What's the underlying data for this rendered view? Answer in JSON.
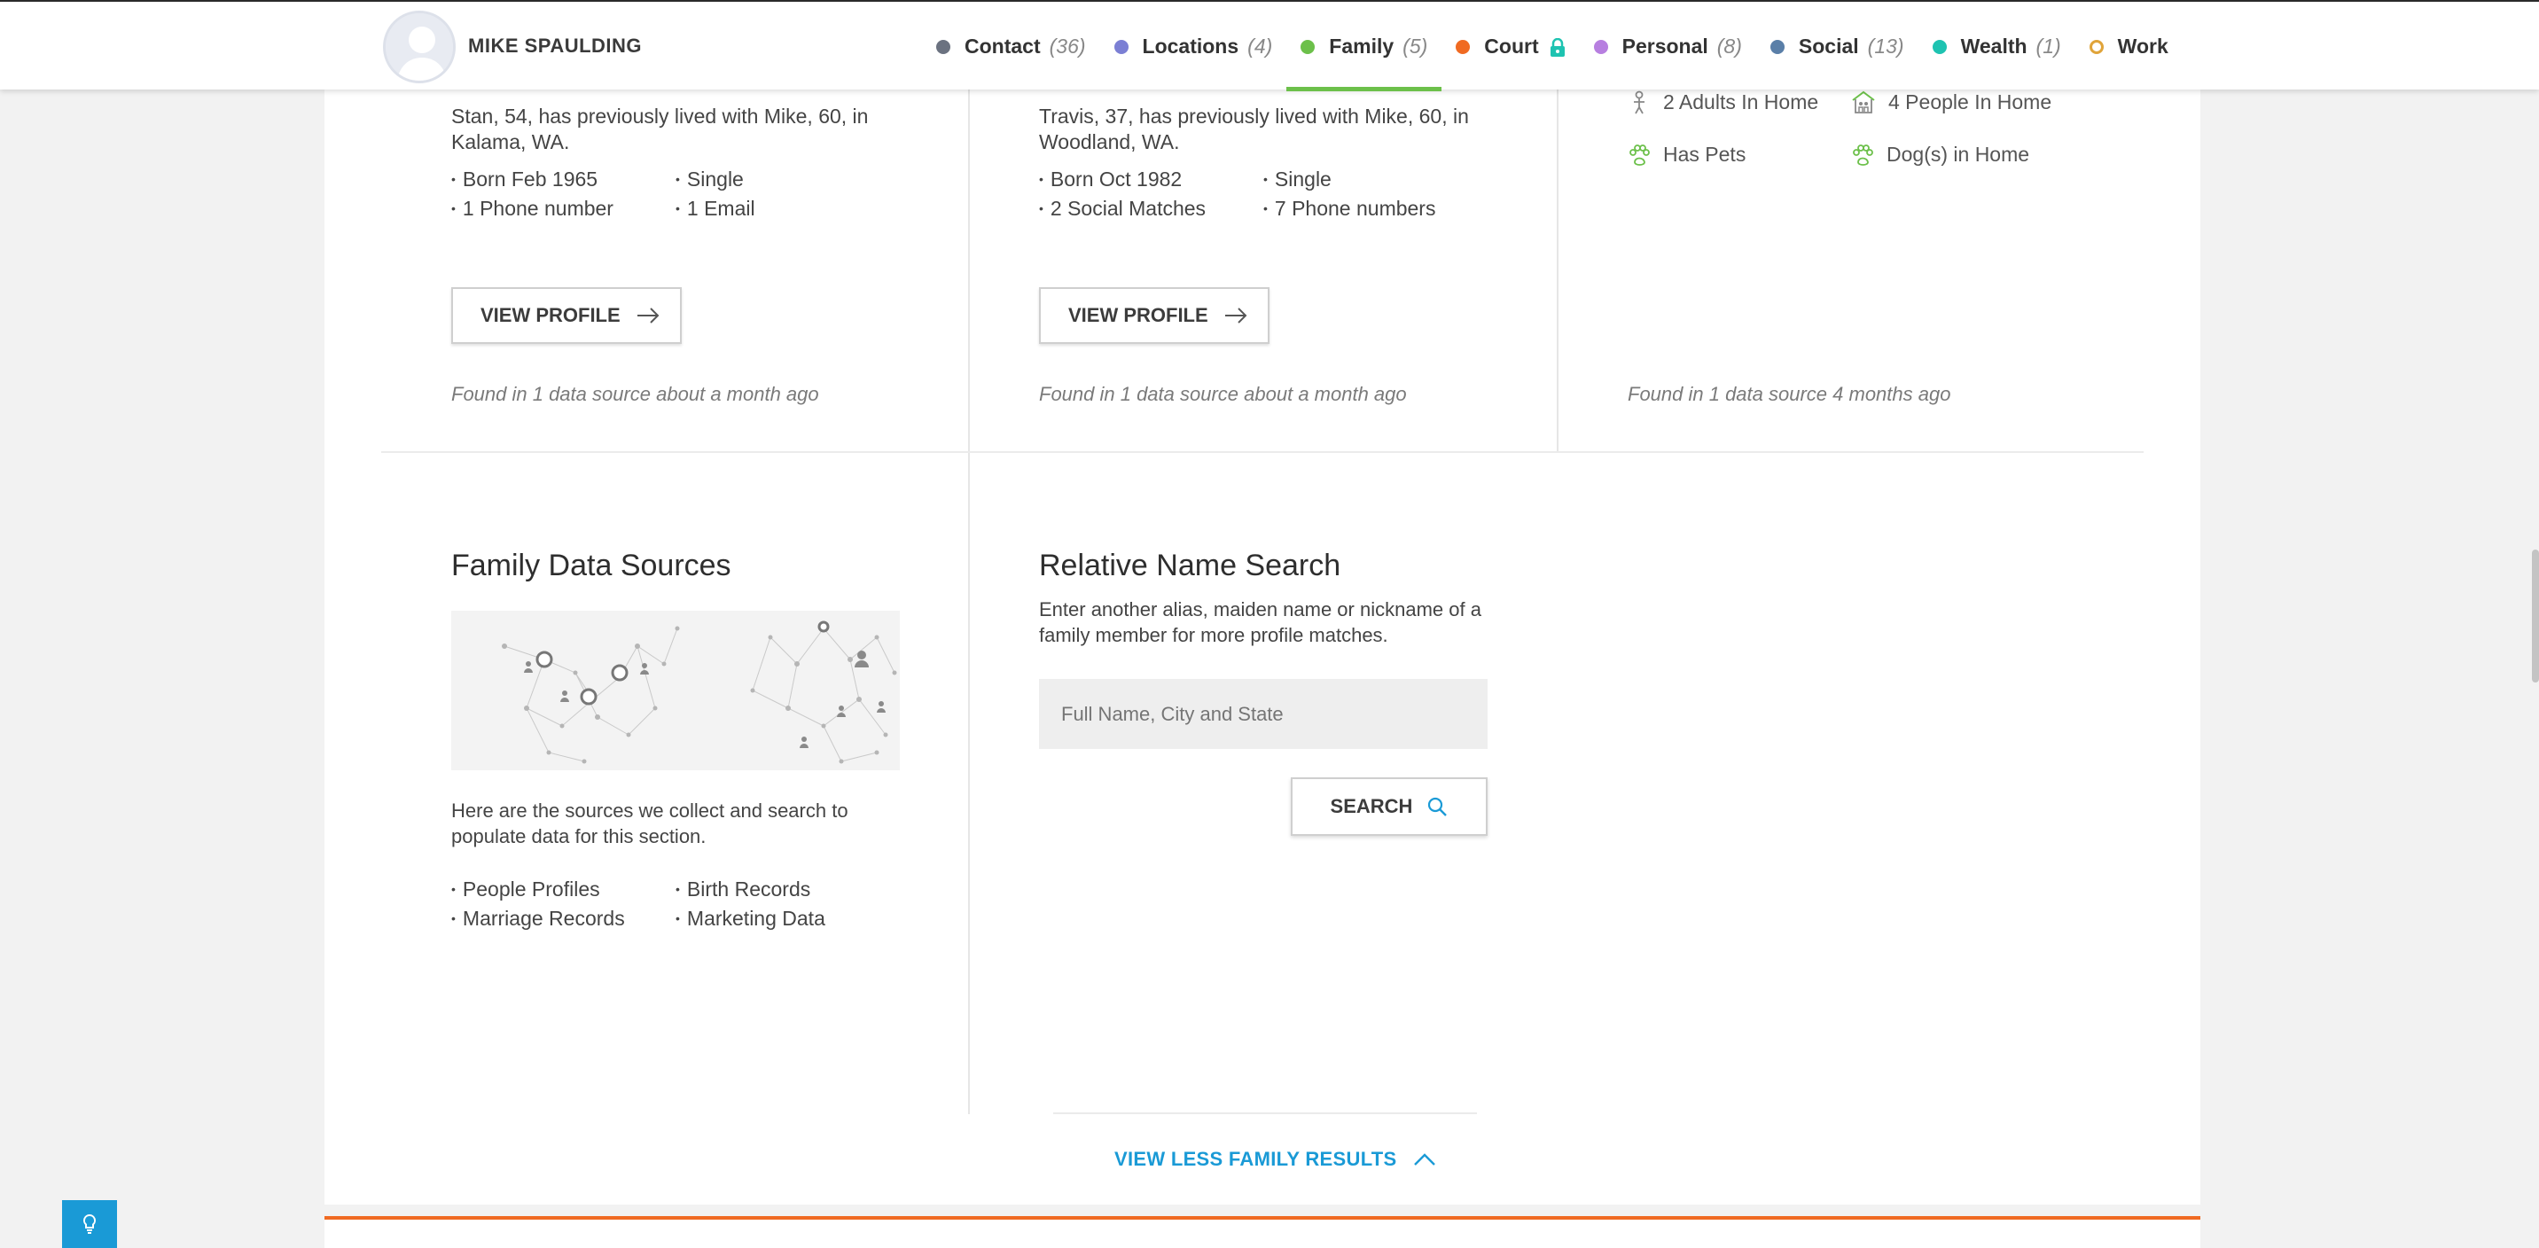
{
  "header": {
    "person_name": "MIKE SPAULDING",
    "tabs": [
      {
        "label": "Contact",
        "count": "(36)",
        "color": "#6b7280"
      },
      {
        "label": "Locations",
        "count": "(4)",
        "color": "#7b7fd4"
      },
      {
        "label": "Family",
        "count": "(5)",
        "color": "#6cc04a",
        "active": true
      },
      {
        "label": "Court",
        "count": "",
        "color": "#f06a22",
        "locked": true
      },
      {
        "label": "Personal",
        "count": "(8)",
        "color": "#b77fe0"
      },
      {
        "label": "Social",
        "count": "(13)",
        "color": "#5a7fa8"
      },
      {
        "label": "Wealth",
        "count": "(1)",
        "color": "#1ec3b1"
      },
      {
        "label": "Work",
        "count": "",
        "color": "#e0a43a",
        "ring": true
      }
    ]
  },
  "relatives": [
    {
      "intro": "Stan, 54, has previously lived with Mike, 60, in Kalama, WA.",
      "facts": [
        "Born Feb 1965",
        "Single",
        "1 Phone number",
        "1 Email"
      ],
      "button": "VIEW PROFILE",
      "found": "Found in 1 data source about a month ago"
    },
    {
      "intro": "Travis, 37, has previously lived with Mike, 60, in Woodland, WA.",
      "facts": [
        "Born Oct 1982",
        "Single",
        "2 Social Matches",
        "7 Phone numbers"
      ],
      "button": "VIEW PROFILE",
      "found": "Found in 1 data source about a month ago"
    }
  ],
  "household": {
    "items": [
      "2 Adults In Home",
      "4 People In Home",
      "Has Pets",
      "Dog(s) in Home"
    ],
    "found": "Found in 1 data source 4 months ago"
  },
  "sources": {
    "title": "Family Data Sources",
    "description": "Here are the sources we collect and search to populate data for this section.",
    "items": [
      "People Profiles",
      "Birth Records",
      "Marriage Records",
      "Marketing Data"
    ]
  },
  "relative_search": {
    "title": "Relative Name Search",
    "description": "Enter another alias, maiden name or nickname of a family member for more profile matches.",
    "placeholder": "Full Name, City and State",
    "button": "SEARCH"
  },
  "footer_link": "VIEW LESS FAMILY RESULTS",
  "colors": {
    "accent": "#1a9ad6",
    "family_green": "#6cc04a",
    "court_orange": "#f06a22"
  }
}
